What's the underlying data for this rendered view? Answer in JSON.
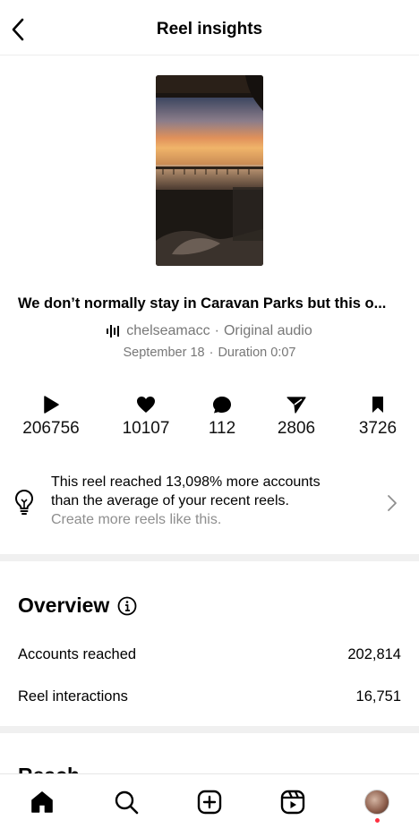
{
  "header": {
    "title": "Reel insights",
    "back_icon": "chevron-left-icon"
  },
  "reel": {
    "caption": "We don’t normally stay in Caravan Parks but this o...",
    "username": "chelseamacc",
    "audio_separator": "·",
    "audio_label": "Original audio",
    "date": "September 18",
    "meta_separator": "·",
    "duration": "Duration 0:07"
  },
  "stats": [
    {
      "icon": "play-icon",
      "value": "206756"
    },
    {
      "icon": "heart-icon",
      "value": "10107"
    },
    {
      "icon": "comment-icon",
      "value": "112"
    },
    {
      "icon": "share-icon",
      "value": "2806"
    },
    {
      "icon": "bookmark-icon",
      "value": "3726"
    }
  ],
  "tip": {
    "line1": "This reel reached 13,098% more accounts",
    "line2": "than the average of your recent reels.",
    "line3": "Create more reels like this."
  },
  "overview": {
    "title": "Overview",
    "rows": [
      {
        "label": "Accounts reached",
        "value": "202,814"
      },
      {
        "label": "Reel interactions",
        "value": "16,751"
      }
    ]
  },
  "next_section_peek": "Reach",
  "tabbar": [
    "home-icon",
    "search-icon",
    "create-icon",
    "reels-icon",
    "profile-avatar"
  ],
  "colors": {
    "secondary_text": "#777777",
    "notification_dot": "#ff3040",
    "divider": "#f0f0f0"
  }
}
